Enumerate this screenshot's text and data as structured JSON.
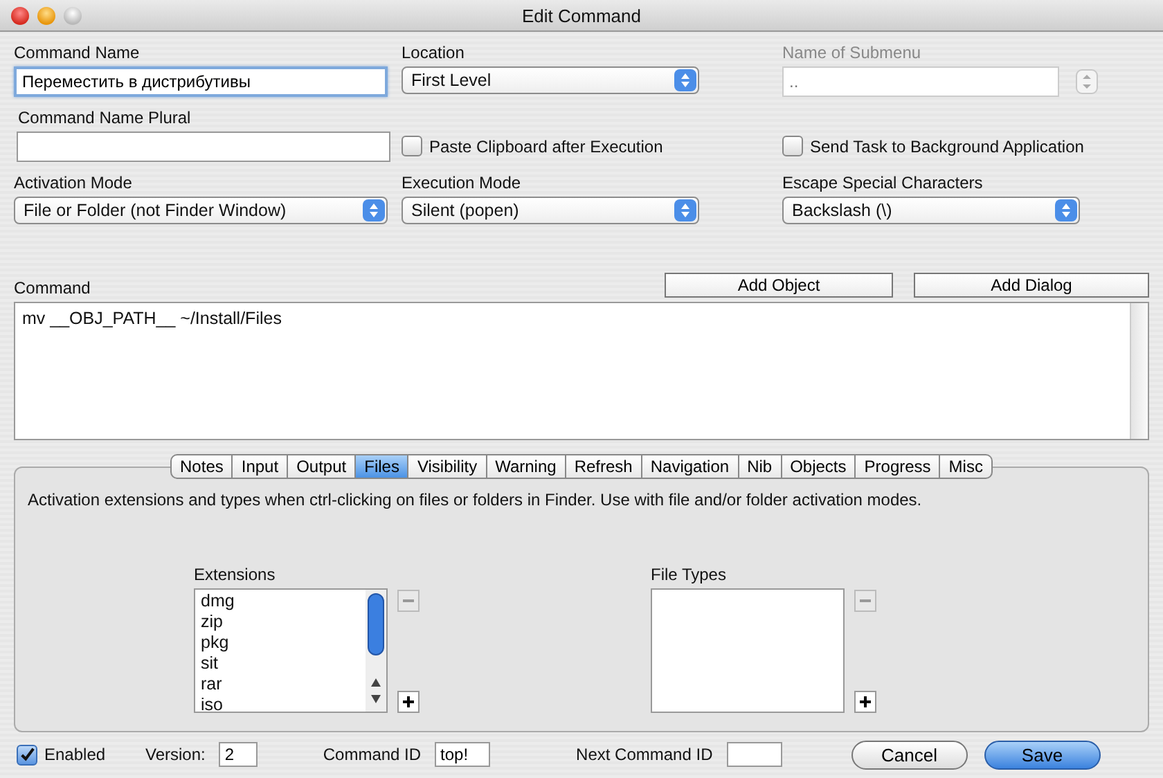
{
  "window": {
    "title": "Edit Command"
  },
  "command_name": {
    "label": "Command Name",
    "value": "Переместить в дистрибутивы"
  },
  "location": {
    "label": "Location",
    "value": "First Level"
  },
  "submenu": {
    "label": "Name of Submenu",
    "placeholder": "..",
    "disabled": true
  },
  "command_name_plural": {
    "label": "Command Name Plural"
  },
  "paste_clipboard": {
    "label": "Paste Clipboard after Execution",
    "checked": false
  },
  "send_task": {
    "label": "Send Task to Background Application",
    "checked": false
  },
  "activation_mode": {
    "label": "Activation Mode",
    "value": "File or Folder (not Finder Window)"
  },
  "execution_mode": {
    "label": "Execution Mode",
    "value": "Silent (popen)"
  },
  "escape_characters": {
    "label": "Escape Special Characters",
    "value": "Backslash (\\)"
  },
  "command": {
    "label": "Command",
    "value": "mv __OBJ_PATH__ ~/Install/Files",
    "buttons": [
      "Add Object",
      "Add Dialog"
    ]
  },
  "tabs": [
    {
      "label": "Notes",
      "selected": false
    },
    {
      "label": "Input",
      "selected": false
    },
    {
      "label": "Output",
      "selected": false
    },
    {
      "label": "Files",
      "selected": true
    },
    {
      "label": "Visibility",
      "selected": false
    },
    {
      "label": "Warning",
      "selected": false
    },
    {
      "label": "Refresh",
      "selected": false
    },
    {
      "label": "Navigation",
      "selected": false
    },
    {
      "label": "Nib",
      "selected": false
    },
    {
      "label": "Objects",
      "selected": false
    },
    {
      "label": "Progress",
      "selected": false
    },
    {
      "label": "Misc",
      "selected": false
    }
  ],
  "tab_panel": {
    "description": "Activation extensions and types when ctrl-clicking on files or folders in Finder. Use with file and/or folder activation modes.",
    "extensions": {
      "label": "Extensions",
      "items": [
        "dmg",
        "zip",
        "pkg",
        "sit",
        "rar",
        "iso"
      ]
    },
    "file_types": {
      "label": "File Types"
    }
  },
  "footer": {
    "enabled": {
      "label": "Enabled",
      "checked": true
    },
    "version": {
      "label": "Version:",
      "value": "2"
    },
    "command_id": {
      "label": "Command ID",
      "value": "top!"
    },
    "next_command_id": {
      "label": "Next Command ID"
    },
    "buttons": [
      {
        "label": "Cancel",
        "kind": "normal"
      },
      {
        "label": "Save",
        "kind": "default"
      }
    ]
  }
}
